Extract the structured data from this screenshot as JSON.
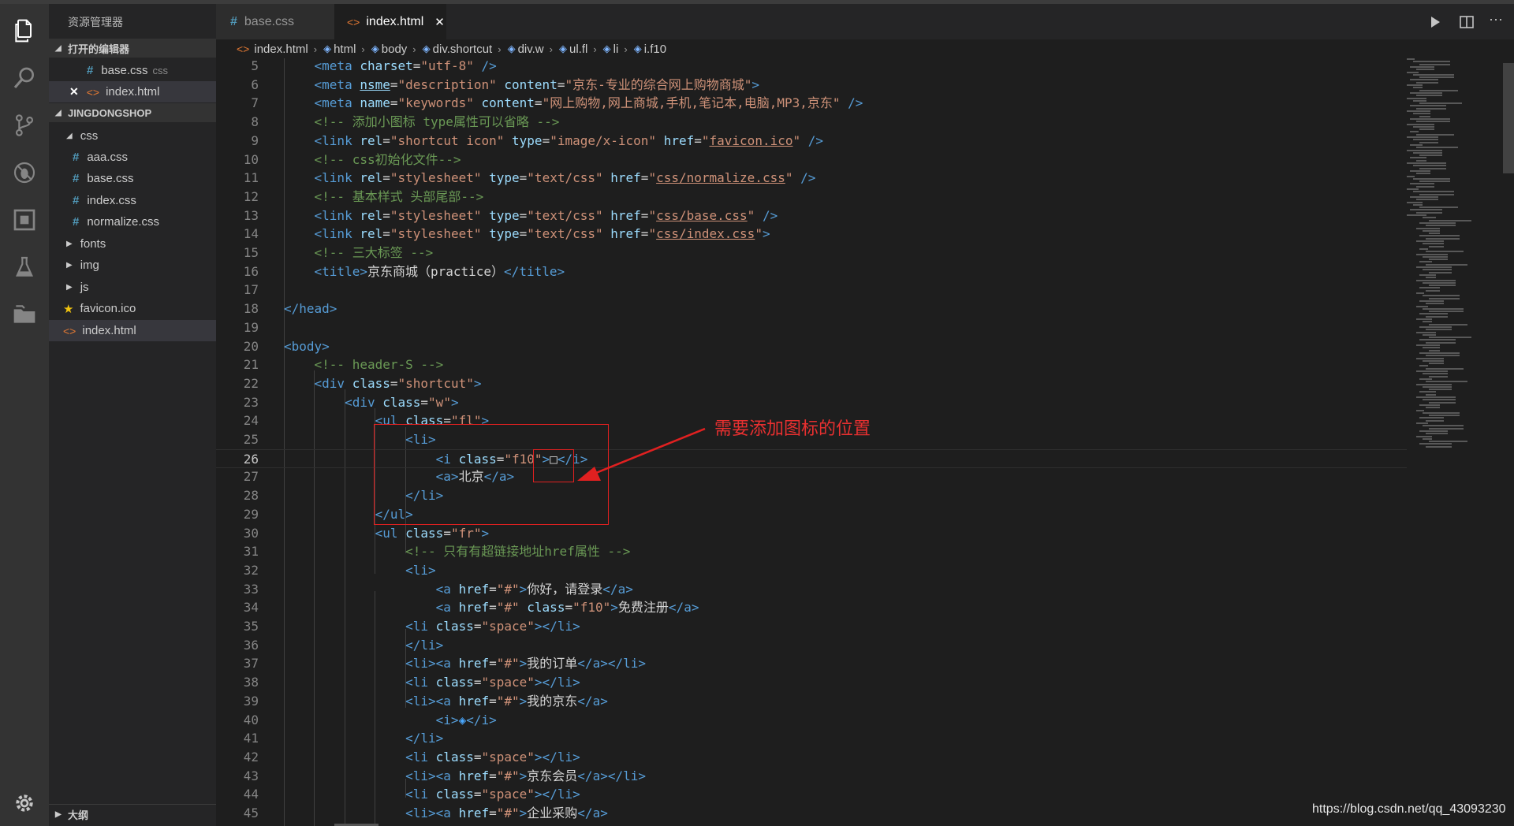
{
  "sidebar": {
    "title": "资源管理器",
    "open_editors": {
      "label": "打开的编辑器",
      "items": [
        {
          "name": "base.css",
          "hint": "css"
        },
        {
          "name": "index.html"
        }
      ]
    },
    "project": {
      "label": "JINGDONGSHOP",
      "items": [
        {
          "name": "css"
        },
        {
          "name": "aaa.css"
        },
        {
          "name": "base.css"
        },
        {
          "name": "index.css"
        },
        {
          "name": "normalize.css"
        },
        {
          "name": "fonts"
        },
        {
          "name": "img"
        },
        {
          "name": "js"
        },
        {
          "name": "favicon.ico"
        },
        {
          "name": "index.html"
        }
      ]
    },
    "outline": "大纲"
  },
  "tabs": [
    {
      "label": "base.css"
    },
    {
      "label": "index.html"
    }
  ],
  "breadcrumb": [
    "index.html",
    "html",
    "body",
    "div.shortcut",
    "div.w",
    "ul.fl",
    "li",
    "i.f10"
  ],
  "editor": {
    "line_numbers": [
      "5",
      "6",
      "7",
      "8",
      "9",
      "10",
      "11",
      "12",
      "13",
      "14",
      "15",
      "16",
      "17",
      "18",
      "19",
      "20",
      "21",
      "22",
      "23",
      "24",
      "25",
      "26",
      "27",
      "28",
      "29",
      "30",
      "31",
      "32",
      "33",
      "34",
      "35",
      "36",
      "37",
      "38",
      "39",
      "40",
      "41",
      "42",
      "43",
      "44",
      "45"
    ],
    "current_line": "26"
  },
  "annotation": "需要添加图标的位置",
  "watermark": "https://blog.csdn.net/qq_43093230",
  "colors": {
    "accent": "#e02020",
    "tag": "#569cd6",
    "attr": "#9cdcfe",
    "string": "#ce9178",
    "comment": "#6a9955"
  }
}
